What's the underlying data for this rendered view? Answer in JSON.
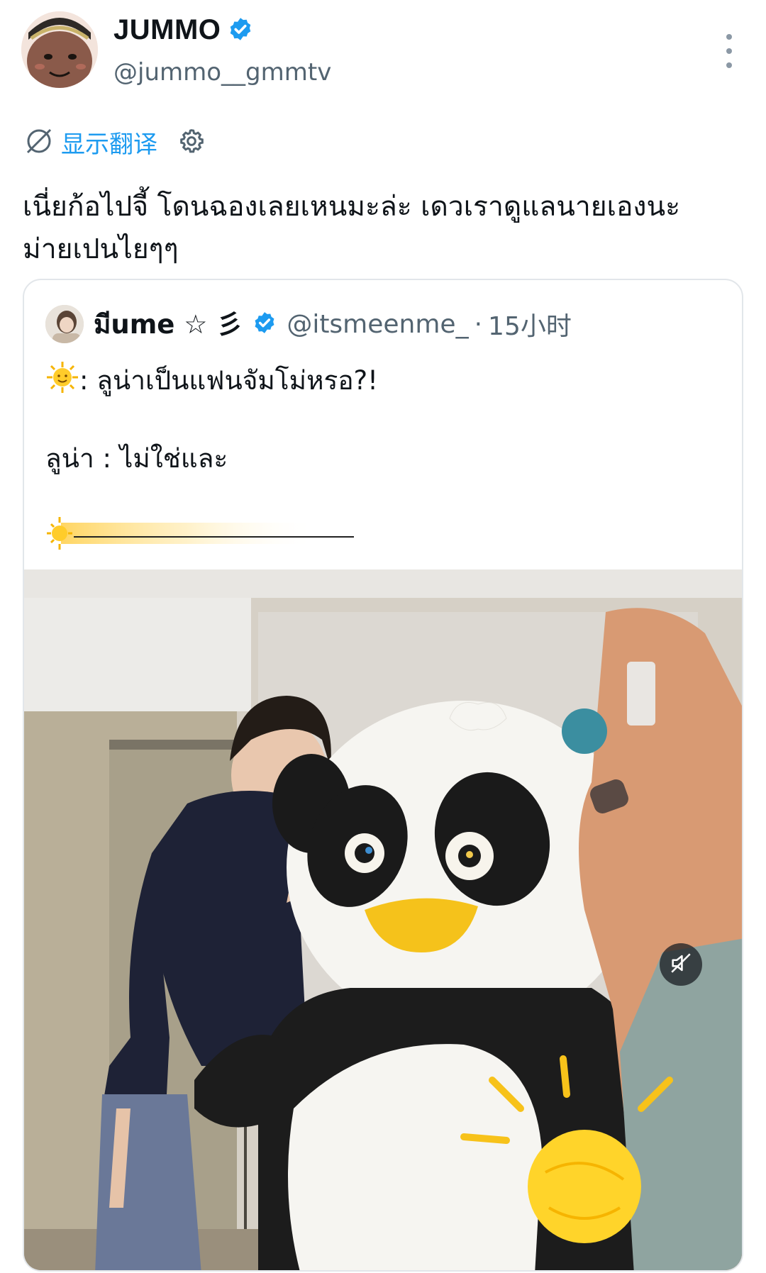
{
  "author": {
    "display_name": "JUMMO",
    "handle": "@jummo__gmmtv",
    "verified": true
  },
  "translate": {
    "label": "显示翻译"
  },
  "tweet": {
    "text_line1": "เนี่ยก้อไปจี้ โดนฉองเลยเหนมะล่ะ เดวเราดูแลนายเองนะ",
    "text_line2": "ม่ายเปนไยๆๆ"
  },
  "quote": {
    "display_name": "มีume ☆ 彡",
    "handle": "@itsmeenme_",
    "separator": "·",
    "time": "15小时",
    "line1": ": ลูน่าเป็นแฟนจัมโม่หรอ?!",
    "line2": "ลูน่า : ไม่ใช่และ"
  },
  "colors": {
    "accent": "#1d9bf0",
    "secondary_text": "#536471",
    "border": "#e2e6ea"
  },
  "icons": [
    "more-vertical-icon",
    "translate-icon",
    "settings-gear-icon",
    "verified-badge-icon",
    "sun-emoji-icon",
    "mute-icon"
  ]
}
